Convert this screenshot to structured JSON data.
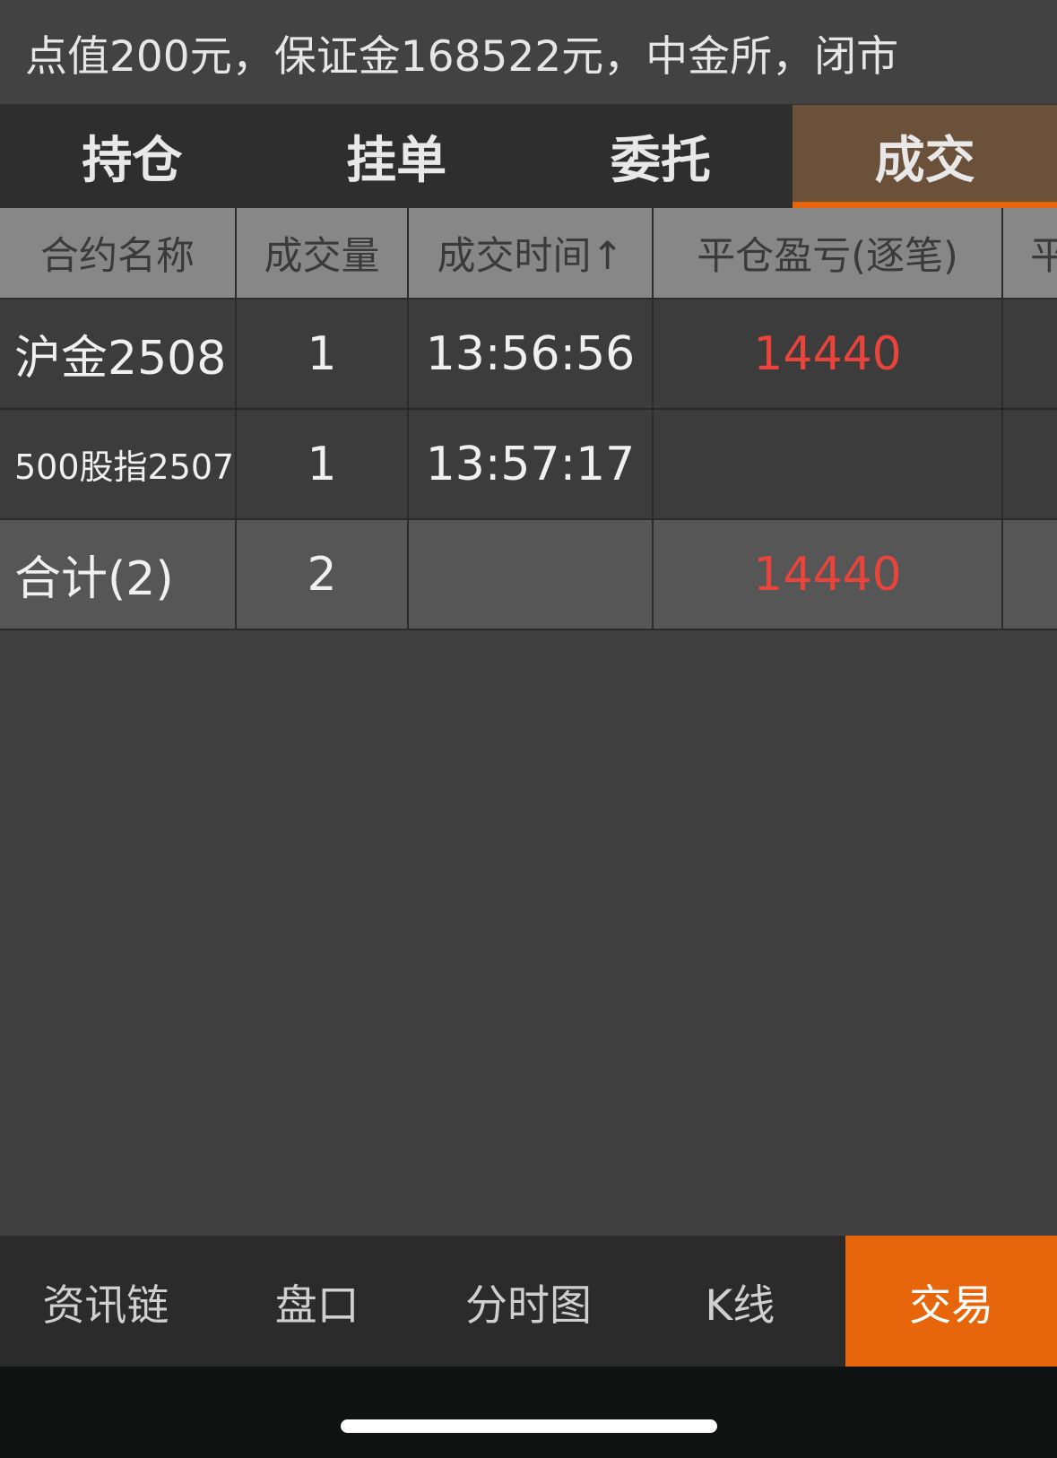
{
  "info_bar": {
    "text": "点值200元，保证金168522元，中金所，闭市"
  },
  "tabs": [
    {
      "label": "持仓"
    },
    {
      "label": "挂单"
    },
    {
      "label": "委托"
    },
    {
      "label": "成交"
    }
  ],
  "active_tab": "成交",
  "table": {
    "headers": [
      "合约名称",
      "成交量",
      "成交时间↑",
      "平仓盈亏(逐笔)",
      "平"
    ],
    "rows": [
      {
        "name": "沪金2508",
        "volume": "1",
        "time": "13:56:56",
        "pnl": "14440"
      },
      {
        "name": "500股指2507",
        "volume": "1",
        "time": "13:57:17",
        "pnl": ""
      }
    ],
    "total": {
      "name": "合计(2)",
      "volume": "2",
      "time": "",
      "pnl": "14440"
    }
  },
  "bottom_nav": [
    {
      "label": "资讯链"
    },
    {
      "label": "盘口"
    },
    {
      "label": "分时图"
    },
    {
      "label": "K线"
    },
    {
      "label": "交易"
    }
  ],
  "active_nav": "交易",
  "colors": {
    "accent": "#e8660b",
    "profit": "#e8443c",
    "active_tab_bg": "#6b503a"
  }
}
